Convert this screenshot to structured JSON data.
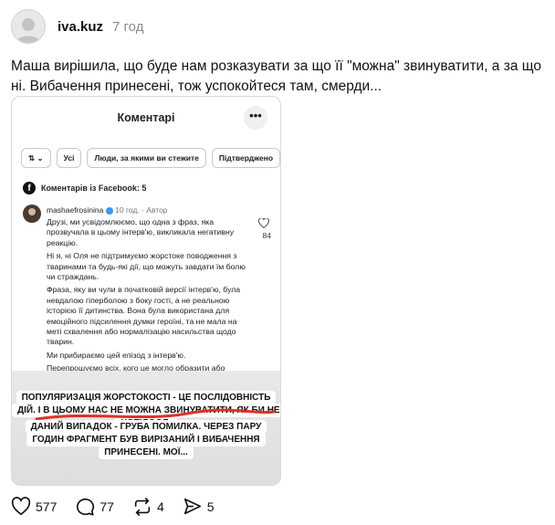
{
  "post": {
    "author": "iva.kuz",
    "time": "7 год",
    "text": "Маша вирішила, що буде нам розказувати за що її \"можна\" звинуватити, а за що ні. Вибачення принесені, тож успокойтеся там, смерди..."
  },
  "media": {
    "title": "Коментарі",
    "more": "•••",
    "filters": [
      "⇅ ⌄",
      "Усі",
      "Люди, за якими ви стежите",
      "Підтверджено"
    ],
    "facebook_label": "Коментарів із Facebook: 5",
    "comment": {
      "username": "mashaefrosinina",
      "meta": "10 год. · Автор",
      "likes": "84",
      "paragraphs": [
        "Друзі, ми усвідомлюємо, що одна з фраз, яка прозвучала в цьому інтерв'ю, викликала негативну реакцію.",
        "Ні я, ні Оля не підтримуємо жорстоке поводження з тваринами та будь-які дії, що можуть завдати їм болю чи страждань.",
        "Фраза, яку ви чули в початковій версії інтерв'ю, була невдалою гіперболою з боку гості, а не реальною історією її дитинства. Вона була використана для емоційного підсилення думки героїні, та не мала на меті схвалення або нормалізацію насильства щодо тварин.",
        "Ми прибираємо цей епізод з інтерв'ю.",
        "Перепрошуємо всіх, кого це могло образити або засмутити."
      ]
    },
    "caption1": "ПОПУЛЯРИЗАЦІЯ ЖОРСТОКОСТІ - ЦЕ ПОСЛІДОВНІСТЬ ДІЙ. І В ЦЬОМУ НАС НЕ МОЖНА ЗВИНУВАТИТИ, ЯК БИ НЕ ХОТІЛОСЯ.",
    "caption2": "ДАНИЙ ВИПАДОК - ГРУБА ПОМИЛКА. ЧЕРЕЗ ПАРУ ГОДИН ФРАГМЕНТ БУВ ВИРІЗАНИЙ І ВИБАЧЕННЯ ПРИНЕСЕНІ. МОЇ..."
  },
  "actions": {
    "likes": "577",
    "comments": "77",
    "reposts": "4",
    "shares": "5"
  },
  "colors": {
    "scribble": "#e0302b",
    "verified": "#3897f0"
  }
}
